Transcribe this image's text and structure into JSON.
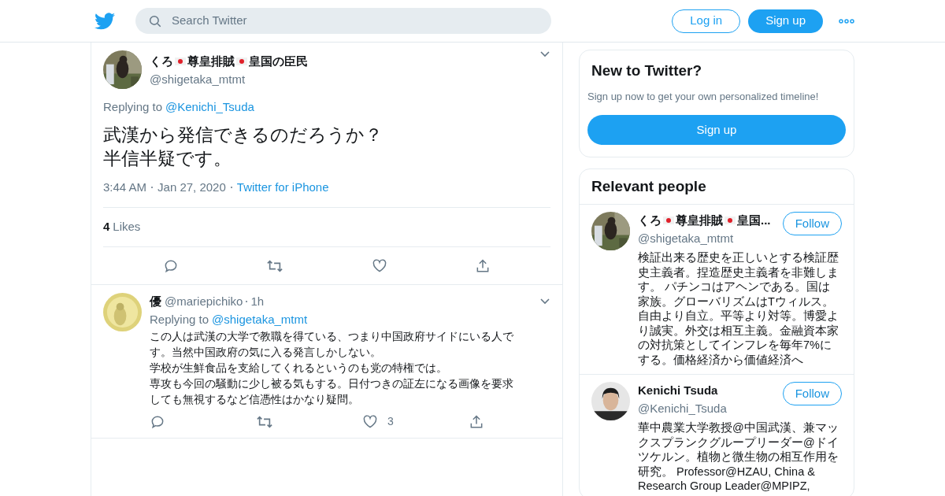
{
  "header": {
    "search": {
      "placeholder": "Search Twitter"
    },
    "login": "Log in",
    "signup": "Sign up"
  },
  "main_tweet": {
    "name_parts": [
      {
        "kind": "text",
        "text": "くろ"
      },
      {
        "kind": "flag"
      },
      {
        "kind": "text",
        "text": "尊皇排賊"
      },
      {
        "kind": "flag"
      },
      {
        "kind": "text",
        "text": "皇国の臣民"
      }
    ],
    "handle": "@shigetaka_mtmt",
    "replying_label": "Replying to",
    "replying_to": "@Kenichi_Tsuda",
    "text_lines": [
      "武漢から発信できるのだろうか？",
      "半信半疑です。"
    ],
    "time": "3:44 AM",
    "date": "Jan 27, 2020",
    "source": "Twitter for iPhone",
    "likes_count": "4",
    "likes_label": "Likes"
  },
  "reply": {
    "name": "優",
    "handle": "@mariepichiko",
    "age": "1h",
    "replying_label": "Replying to",
    "replying_to": "@shigetaka_mtmt",
    "text_lines": [
      "この人は武漢の大学で教職を得ている、つまり中国政府サイドにいる人で",
      "す。当然中国政府の気に入る発言しかしない。",
      "学校が生鮮食品を支給してくれるというのも党の特権では。",
      "専攻も今回の騒動に少し被る気もする。日付つきの証左になる画像を要求",
      "しても無視するなど信憑性はかなり疑問。"
    ],
    "like_count": "3"
  },
  "new_to_twitter": {
    "title": "New to Twitter?",
    "subtitle": "Sign up now to get your own personalized timeline!",
    "button": "Sign up"
  },
  "relevant_people": {
    "title": "Relevant people",
    "people": [
      {
        "name_parts": [
          {
            "kind": "text",
            "text": "くろ"
          },
          {
            "kind": "flag"
          },
          {
            "kind": "text",
            "text": "尊皇排賊"
          },
          {
            "kind": "flag"
          },
          {
            "kind": "text",
            "text": "皇国..."
          }
        ],
        "handle": "@shigetaka_mtmt",
        "follow": "Follow",
        "bio_lines": [
          "検証出来る歴史を正しいとする検証歴",
          "史主義者。捏造歴史主義者を非難しま",
          "す。 パチンコはアヘンである。国は",
          "家族。グローバリズムはTウィルス。",
          "自由より自立。平等より対等。博愛よ",
          "り誠実。外交は相互主義。金融資本家",
          "の対抗策としてインフレを毎年7%に",
          "する。価格経済から価値経済へ"
        ]
      },
      {
        "name_parts": [
          {
            "kind": "text",
            "text": "Kenichi Tsuda"
          }
        ],
        "handle": "@Kenichi_Tsuda",
        "follow": "Follow",
        "bio_lines": [
          "華中農業大学教授@中国武漢、兼マッ",
          "クスプランクグループリーダー@ドイ",
          "ツケルン。植物と微生物の相互作用を",
          "研究。 Professor@HZAU, China &",
          "Research Group Leader@MPIPZ,"
        ]
      }
    ]
  }
}
